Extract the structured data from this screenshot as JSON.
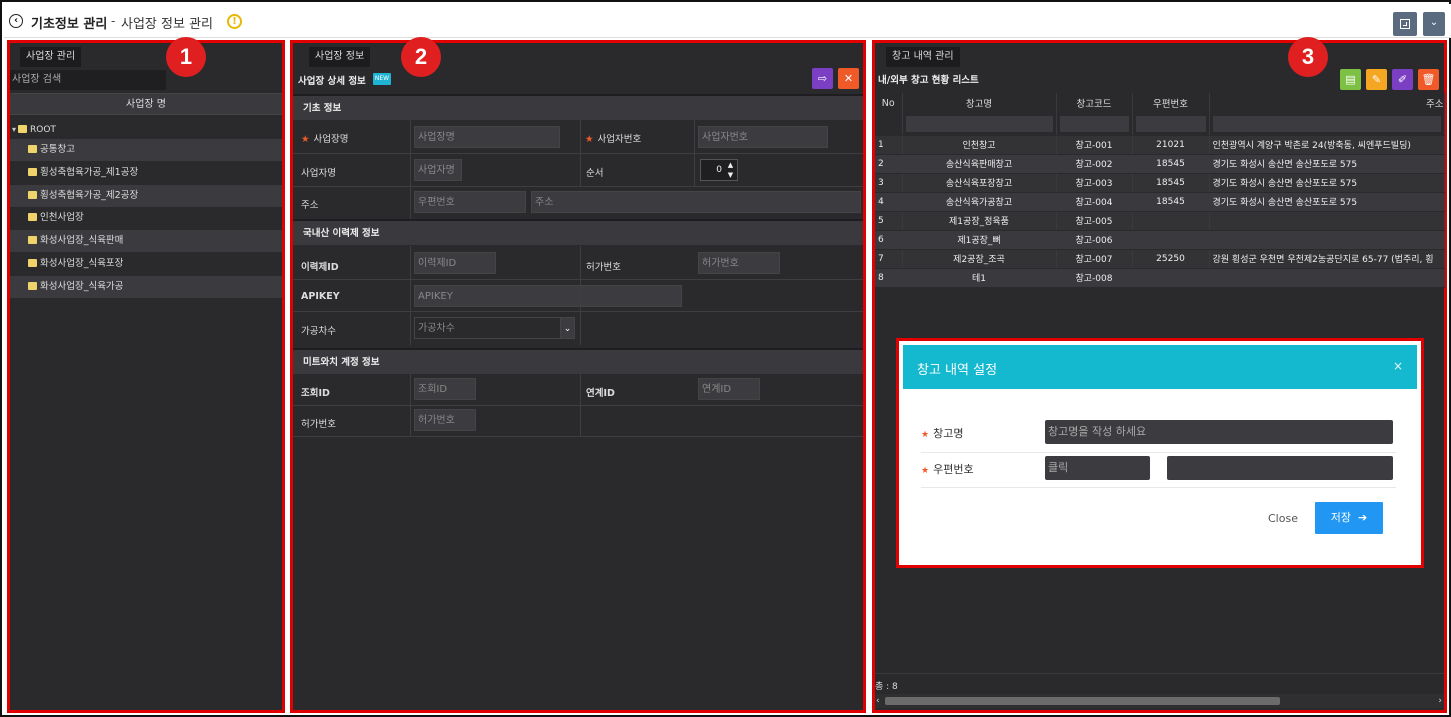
{
  "header": {
    "title": "기초정보 관리",
    "separator": "-",
    "subtitle": "사업장 정보 관리"
  },
  "left_panel": {
    "tab_label": "사업장 관리",
    "badge": "1",
    "search_placeholder": "사업장 검색",
    "column_header": "사업장 명",
    "root_label": "ROOT",
    "items": [
      {
        "label": "공통창고"
      },
      {
        "label": "횡성축협육가공_제1공장"
      },
      {
        "label": "횡성축협육가공_제2공장"
      },
      {
        "label": "인천사업장"
      },
      {
        "label": "화성사업장_식육판매"
      },
      {
        "label": "화성사업장_식육포장"
      },
      {
        "label": "화성사업장_식육가공"
      }
    ]
  },
  "middle_panel": {
    "tab_label": "사업장 정보",
    "badge": "2",
    "sub_title": "사업장 상세 정보",
    "new_badge": "NEW",
    "sections": {
      "basic": "기초 정보",
      "trace": "국내산 이력제 정보",
      "meat": "미트와치 계정 정보"
    },
    "fields": {
      "biz_name_label": "사업장명",
      "biz_name_placeholder": "사업장명",
      "biz_no_label": "사업자번호",
      "biz_no_placeholder": "사업자번호",
      "biz_type_label": "사업자명",
      "biz_type_placeholder": "사업자명",
      "order_label": "순서",
      "order_value": "0",
      "address_label": "주소",
      "zip_placeholder": "우편번호",
      "address_placeholder": "주소",
      "trace_id_label": "이력제ID",
      "trace_id_placeholder": "이력제ID",
      "permit_label": "허가번호",
      "permit_placeholder": "허가번호",
      "apikey_label": "APIKEY",
      "apikey_placeholder": "APIKEY",
      "processor_label": "가공차수",
      "processor_placeholder": "가공차수",
      "query_id_label": "조회ID",
      "query_id_placeholder": "조회ID",
      "link_id_label": "연계ID",
      "link_id_placeholder": "연계ID",
      "permit2_label": "허가번호",
      "permit2_placeholder": "허가번호"
    }
  },
  "right_panel": {
    "tab_label": "창고 내역 관리",
    "badge": "3",
    "list_title": "내/외부 창고 현황 리스트",
    "columns": [
      "No",
      "창고명",
      "창고코드",
      "우편번호",
      "주소"
    ],
    "rows": [
      {
        "no": "1",
        "name": "인천창고",
        "code": "창고-001",
        "zip": "21021",
        "addr": "인천광역시 계양구 박촌로 24(방축동, 씨엔푸드빌딩)"
      },
      {
        "no": "2",
        "name": "송산식육판매창고",
        "code": "창고-002",
        "zip": "18545",
        "addr": "경기도 화성시 송산면 송산포도로 575"
      },
      {
        "no": "3",
        "name": "송산식육포장창고",
        "code": "창고-003",
        "zip": "18545",
        "addr": "경기도 화성시 송산면 송산포도로 575"
      },
      {
        "no": "4",
        "name": "송산식육가공창고",
        "code": "창고-004",
        "zip": "18545",
        "addr": "경기도 화성시 송산면 송산포도로 575"
      },
      {
        "no": "5",
        "name": "제1공장_정육품",
        "code": "창고-005",
        "zip": "",
        "addr": ""
      },
      {
        "no": "6",
        "name": "제1공장_뼈",
        "code": "창고-006",
        "zip": "",
        "addr": ""
      },
      {
        "no": "7",
        "name": "제2공장_조곡",
        "code": "창고-007",
        "zip": "25250",
        "addr": "강원 횡성군 우천면 우천제2농공단지로 65-77 (법주리, 횡"
      },
      {
        "no": "8",
        "name": "테1",
        "code": "창고-008",
        "zip": "",
        "addr": ""
      }
    ],
    "footer_count": "총 : 8"
  },
  "dialog": {
    "title": "창고 내역 설정",
    "close_x": "×",
    "name_label": "창고명",
    "name_placeholder": "창고명을 작성 하세요",
    "zip_label": "우편번호",
    "zip_placeholder": "클릭",
    "close_button": "Close",
    "save_button": "저장",
    "save_arrow": "➔"
  },
  "colors": {
    "panel_bg": "#2a2a2d",
    "highlight_border": "#e00000",
    "dialog_header": "#14b9cf",
    "save_button": "#2196f3",
    "excel_green": "#7cc144",
    "edit_orange": "#f5a623",
    "edit_purple": "#7b3fc4",
    "delete_orange": "#f05a28"
  }
}
